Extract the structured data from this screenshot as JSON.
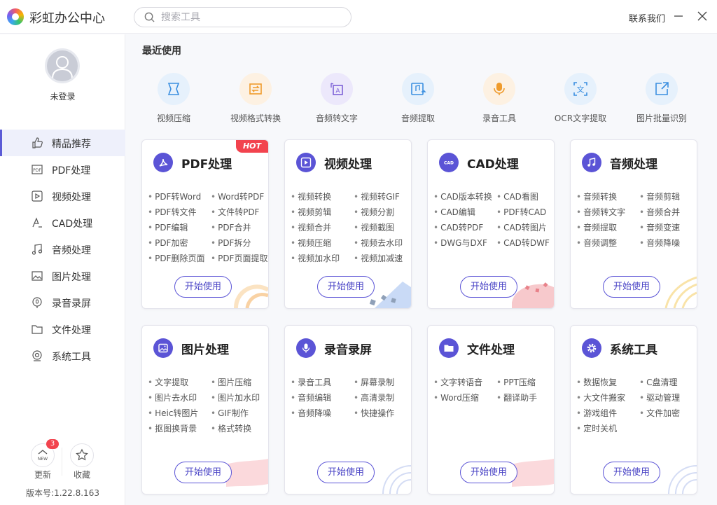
{
  "app": {
    "title": "彩虹办公中心"
  },
  "search": {
    "placeholder": "搜索工具"
  },
  "header": {
    "contact": "联系我们"
  },
  "user": {
    "status": "未登录"
  },
  "sidebar": {
    "items": [
      {
        "label": "精品推荐",
        "icon": "thumbs-up-icon",
        "active": true
      },
      {
        "label": "PDF处理",
        "icon": "pdf-icon"
      },
      {
        "label": "视频处理",
        "icon": "video-icon"
      },
      {
        "label": "CAD处理",
        "icon": "cad-icon"
      },
      {
        "label": "音频处理",
        "icon": "music-icon"
      },
      {
        "label": "图片处理",
        "icon": "image-icon"
      },
      {
        "label": "录音录屏",
        "icon": "mic-icon"
      },
      {
        "label": "文件处理",
        "icon": "folder-icon"
      },
      {
        "label": "系统工具",
        "icon": "system-icon"
      }
    ],
    "update_label": "更新",
    "update_badge": "3",
    "favorite_label": "收藏",
    "version": "版本号:1.22.8.163"
  },
  "recent": {
    "title": "最近使用",
    "items": [
      {
        "label": "视频压缩",
        "icon": "compress-icon"
      },
      {
        "label": "视频格式转换",
        "icon": "convert-icon"
      },
      {
        "label": "音频转文字",
        "icon": "audio-text-icon"
      },
      {
        "label": "音频提取",
        "icon": "audio-extract-icon"
      },
      {
        "label": "录音工具",
        "icon": "microphone-icon"
      },
      {
        "label": "OCR文字提取",
        "icon": "ocr-icon"
      },
      {
        "label": "图片批量识别",
        "icon": "batch-image-icon"
      }
    ]
  },
  "cards": [
    {
      "title": "PDF处理",
      "icon": "pdf-icon",
      "hot": "HOT",
      "button": "开始使用",
      "features": [
        "PDF转Word",
        "Word转PDF",
        "PDF转文件",
        "文件转PDF",
        "PDF编辑",
        "PDF合并",
        "PDF加密",
        "PDF拆分",
        "PDF删除页面",
        "PDF页面提取"
      ]
    },
    {
      "title": "视频处理",
      "icon": "play-icon",
      "button": "开始使用",
      "features": [
        "视频转换",
        "视频转GIF",
        "视频剪辑",
        "视频分割",
        "视频合并",
        "视频截图",
        "视频压缩",
        "视频去水印",
        "视频加水印",
        "视频加减速"
      ]
    },
    {
      "title": "CAD处理",
      "icon": "cad-icon",
      "button": "开始使用",
      "features": [
        "CAD版本转换",
        "CAD看图",
        "CAD编辑",
        "PDF转CAD",
        "CAD转PDF",
        "CAD转图片",
        "DWG与DXF",
        "CAD转DWF"
      ]
    },
    {
      "title": "音频处理",
      "icon": "music-icon",
      "button": "开始使用",
      "features": [
        "音频转换",
        "音频剪辑",
        "音频转文字",
        "音频合并",
        "音频提取",
        "音频变速",
        "音频调整",
        "音频降噪"
      ]
    },
    {
      "title": "图片处理",
      "icon": "image-icon",
      "button": "开始使用",
      "features": [
        "文字提取",
        "图片压缩",
        "图片去水印",
        "图片加水印",
        "Heic转图片",
        "GIF制作",
        "抠图换背景",
        "格式转换"
      ]
    },
    {
      "title": "录音录屏",
      "icon": "mic-icon",
      "button": "开始使用",
      "features": [
        "录音工具",
        "屏幕录制",
        "音频编辑",
        "高清录制",
        "音频降噪",
        "快捷操作"
      ]
    },
    {
      "title": "文件处理",
      "icon": "folder-icon",
      "button": "开始使用",
      "features": [
        "文字转语音",
        "PPT压缩",
        "Word压缩",
        "翻译助手"
      ]
    },
    {
      "title": "系统工具",
      "icon": "gear-icon",
      "button": "开始使用",
      "features": [
        "数据恢复",
        "C盘清理",
        "大文件搬家",
        "驱动管理",
        "游戏组件",
        "文件加密",
        "定时关机"
      ]
    }
  ]
}
